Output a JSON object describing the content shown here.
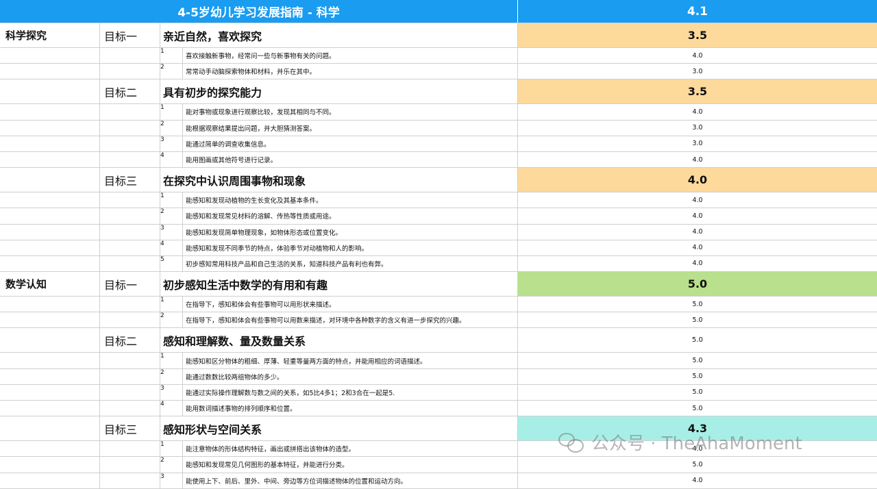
{
  "header": {
    "title": "4-5岁幼儿学习发展指南 - 科学",
    "score": "4.1",
    "bg": "#1a9cf0"
  },
  "colors": {
    "orange": "#fdd99b",
    "green": "#b9e08c",
    "cyan": "#a7efe6",
    "border": "#cfcfcf"
  },
  "sections": [
    {
      "domain": "科学探究",
      "goals": [
        {
          "label": "目标一",
          "title": "亲近自然，喜欢探究",
          "score": "3.5",
          "highlight": "orange",
          "items": [
            {
              "num": "1",
              "text": "喜欢接触新事物，经常问一些与新事物有关的问题。",
              "score": "4.0"
            },
            {
              "num": "2",
              "text": "常常动手动脑探索物体和材料，并乐在其中。",
              "score": "3.0"
            }
          ]
        },
        {
          "label": "目标二",
          "title": "具有初步的探究能力",
          "score": "3.5",
          "highlight": "orange",
          "items": [
            {
              "num": "1",
              "text": "能对事物或现象进行观察比较，发现其相同与不同。",
              "score": "4.0"
            },
            {
              "num": "2",
              "text": "能根据观察结果提出问题，并大胆猜测答案。",
              "score": "3.0"
            },
            {
              "num": "3",
              "text": "能通过简单的调查收集信息。",
              "score": "3.0"
            },
            {
              "num": "4",
              "text": "能用图画或其他符号进行记录。",
              "score": "4.0"
            }
          ]
        },
        {
          "label": "目标三",
          "title": "在探究中认识周围事物和现象",
          "score": "4.0",
          "highlight": "orange",
          "items": [
            {
              "num": "1",
              "text": "能感知和发现动植物的生长变化及其基本条件。",
              "score": "4.0"
            },
            {
              "num": "2",
              "text": "能感知和发现常见材料的溶解、传热等性质或用途。",
              "score": "4.0"
            },
            {
              "num": "3",
              "text": "能感知和发现简单物理现象，如物体形态或位置变化。",
              "score": "4.0"
            },
            {
              "num": "4",
              "text": "能感知和发现不同季节的特点，体验季节对动植物和人的影响。",
              "score": "4.0"
            },
            {
              "num": "5",
              "text": "初步感知常用科技产品和自己生活的关系，知道科技产品有利也有弊。",
              "score": "4.0"
            }
          ]
        }
      ]
    },
    {
      "domain": "数学认知",
      "goals": [
        {
          "label": "目标一",
          "title": "初步感知生活中数学的有用和有趣",
          "score": "5.0",
          "highlight": "green",
          "items": [
            {
              "num": "1",
              "text": "在指导下，感知和体会有些事物可以用形状来描述。",
              "score": "5.0"
            },
            {
              "num": "2",
              "text": "在指导下，感知和体会有些事物可以用数来描述，对环境中各种数字的含义有进一步探究的兴趣。",
              "score": "5.0"
            }
          ]
        },
        {
          "label": "目标二",
          "title": "感知和理解数、量及数量关系",
          "score": "5.0",
          "highlight": "none",
          "items": [
            {
              "num": "1",
              "text": "能感知和区分物体的粗细、厚薄、轻重等量两方面的特点，并能用相应的词语描述。",
              "score": "5.0"
            },
            {
              "num": "2",
              "text": "能通过数数比较两组物体的多少。",
              "score": "5.0"
            },
            {
              "num": "3",
              "text": "能通过实际操作理解数与数之间的关系，如5比4多1；2和3合在一起是5.",
              "score": "5.0"
            },
            {
              "num": "4",
              "text": "能用数词描述事物的排列顺序和位置。",
              "score": "5.0"
            }
          ]
        },
        {
          "label": "目标三",
          "title": "感知形状与空间关系",
          "score": "4.3",
          "highlight": "cyan",
          "items": [
            {
              "num": "1",
              "text": "能注意物体的形体结构特征，画出或拼搭出该物体的造型。",
              "score": "4.0"
            },
            {
              "num": "2",
              "text": "能感知和发现常见几何图形的基本特征，并能进行分类。",
              "score": "5.0"
            },
            {
              "num": "3",
              "text": "能使用上下、前后、里外、中间、旁边等方位词描述物体的位置和运动方向。",
              "score": "4.0"
            }
          ]
        }
      ]
    }
  ],
  "watermark": {
    "icon": "wechat-icon",
    "text": "公众号 · TheAhaMoment"
  }
}
